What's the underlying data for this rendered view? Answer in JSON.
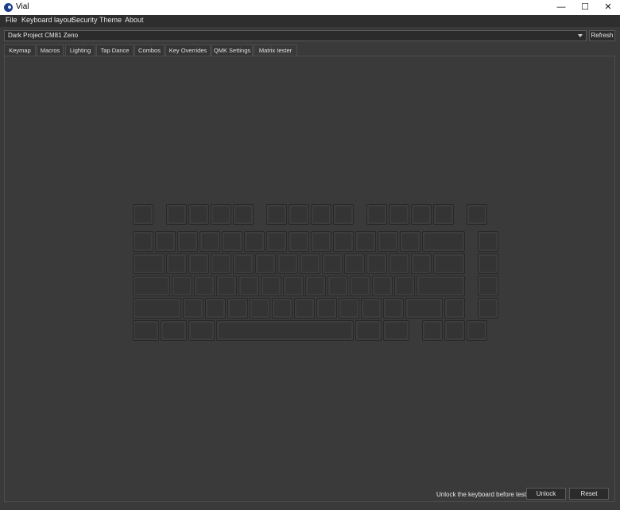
{
  "window": {
    "title": "Vial",
    "minimize_glyph": "—",
    "maximize_glyph": "☐",
    "close_glyph": "✕"
  },
  "menu": [
    "File",
    "Keyboard layout",
    "Security",
    "Theme",
    "About"
  ],
  "device": {
    "selected": "Dark Project CM81 Zeno",
    "refresh_label": "Refresh"
  },
  "tabs": [
    "Keymap",
    "Macros",
    "Lighting",
    "Tap Dance",
    "Combos",
    "Key Overrides",
    "QMK Settings",
    "Matrix tester"
  ],
  "active_tab": "Matrix tester",
  "keyboard": {
    "rows": [
      [
        1,
        "gap",
        1,
        1,
        1,
        1,
        "gap",
        1,
        1,
        1,
        1,
        "gap",
        1,
        1,
        1,
        1,
        "gap",
        1
      ],
      [
        1,
        1,
        1,
        1,
        1,
        1,
        1,
        1,
        1,
        1,
        1,
        1,
        1,
        2,
        "gap",
        1
      ],
      [
        1.5,
        1,
        1,
        1,
        1,
        1,
        1,
        1,
        1,
        1,
        1,
        1,
        1,
        1.5,
        "gap",
        1
      ],
      [
        1.75,
        1,
        1,
        1,
        1,
        1,
        1,
        1,
        1,
        1,
        1,
        1,
        2.25,
        "gap",
        1
      ],
      [
        2.25,
        1,
        1,
        1,
        1,
        1,
        1,
        1,
        1,
        1,
        1,
        1.75,
        1,
        "gap",
        1
      ],
      [
        1.25,
        1.25,
        1.25,
        6.25,
        1.25,
        1.25,
        "gap",
        1,
        1,
        1
      ]
    ]
  },
  "footer": {
    "status": "Unlock the keyboard before testing:",
    "unlock_label": "Unlock",
    "reset_label": "Reset"
  },
  "colors": {
    "background": "#3a3a3a",
    "key_fill": "#343434",
    "key_border": "#282828"
  }
}
